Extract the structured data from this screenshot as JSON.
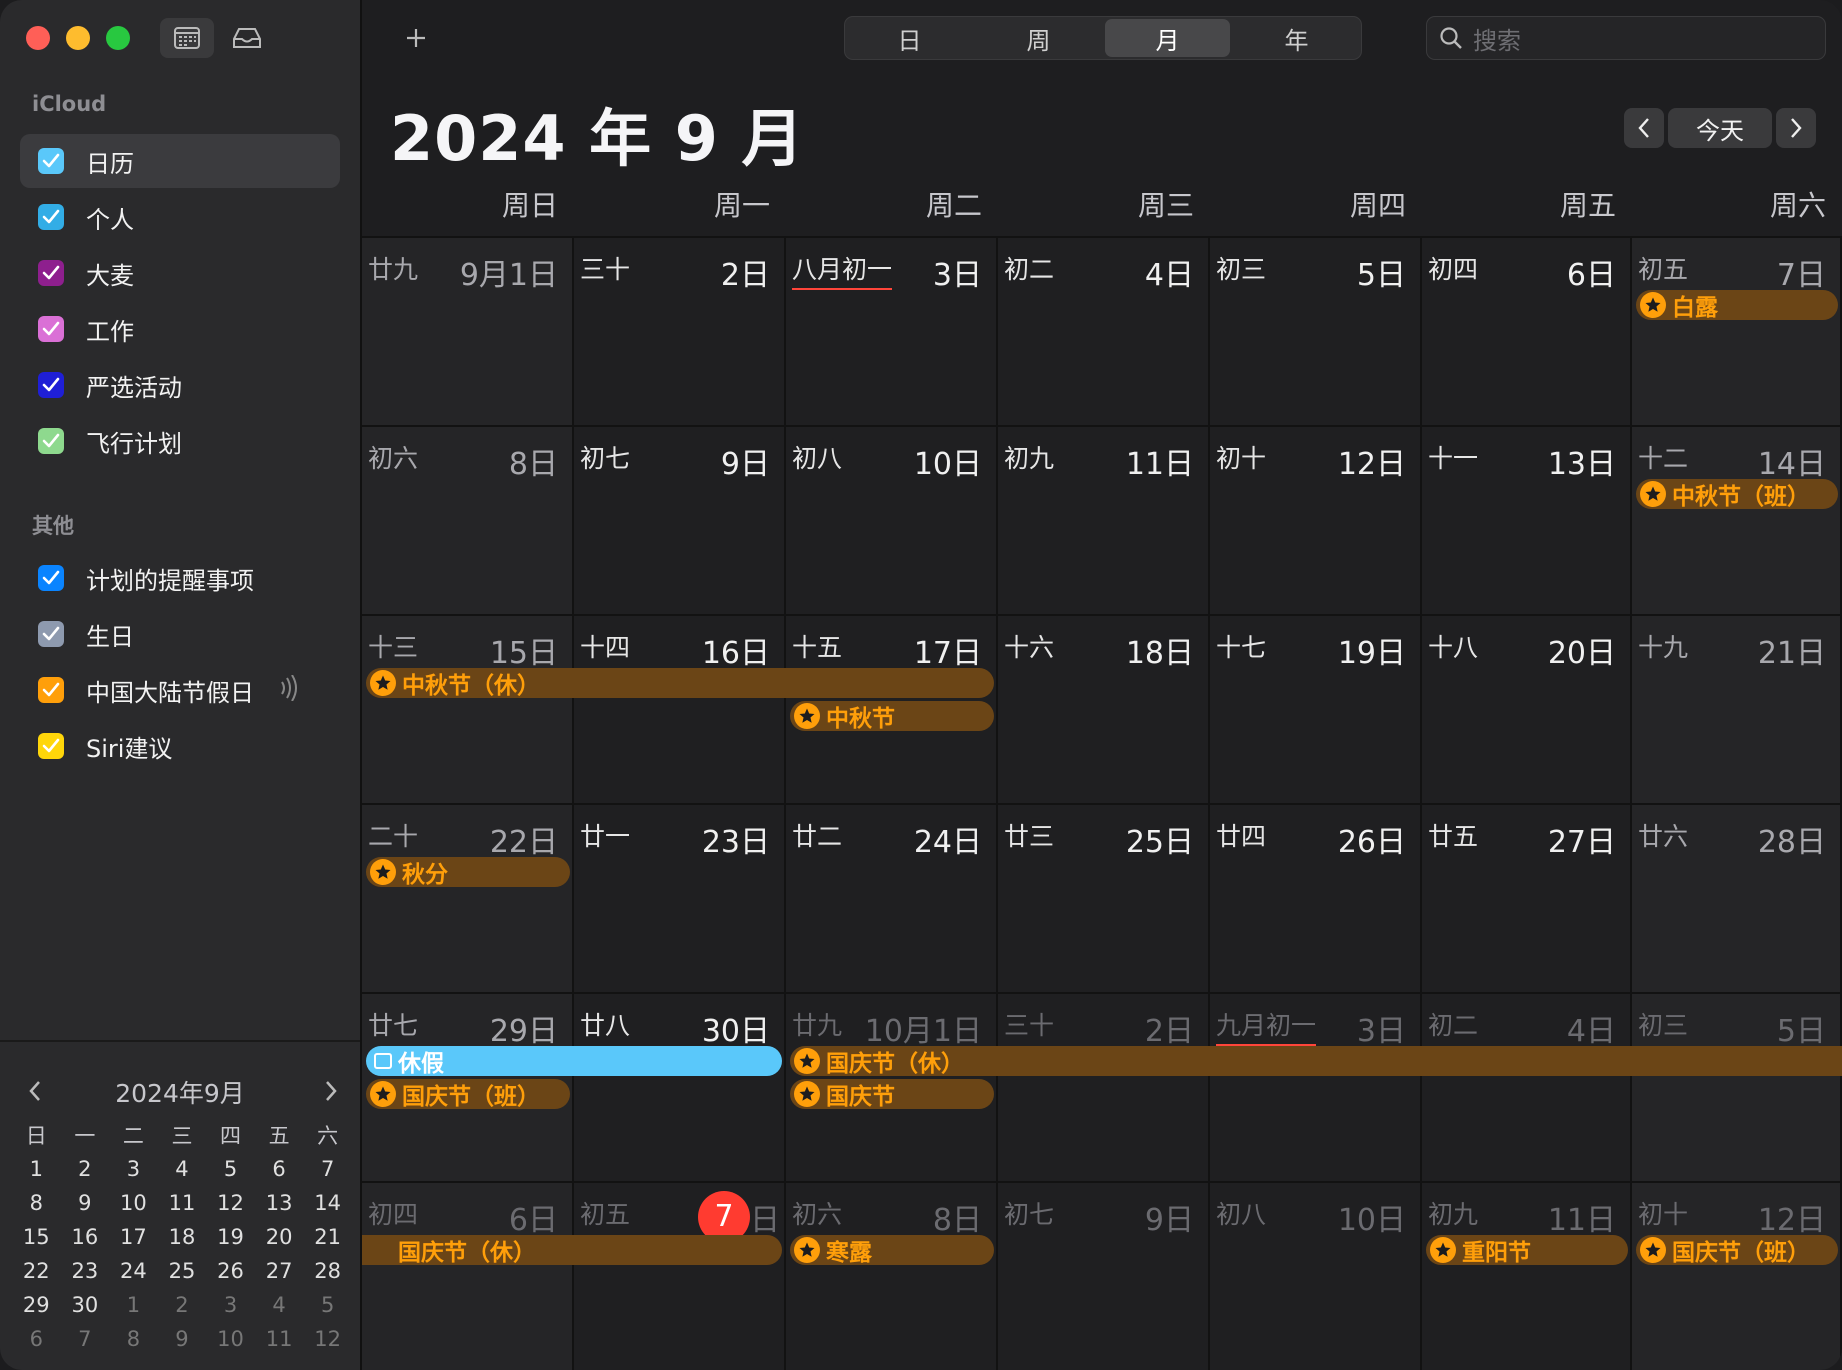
{
  "sidebar": {
    "icloud_heading": "iCloud",
    "icloud_calendars": [
      {
        "label": "日历",
        "color": "#5ac8fa",
        "selected": true
      },
      {
        "label": "个人",
        "color": "#32ade6"
      },
      {
        "label": "大麦",
        "color": "#8e1f8e"
      },
      {
        "label": "工作",
        "color": "#da70d6"
      },
      {
        "label": "严选活动",
        "color": "#1f1fd6"
      },
      {
        "label": "飞行计划",
        "color": "#8ed98e"
      }
    ],
    "other_heading": "其他",
    "other_calendars": [
      {
        "label": "计划的提醒事项",
        "color": "#0a84ff"
      },
      {
        "label": "生日",
        "color": "#8e9aaf"
      },
      {
        "label": "中国大陆节假日",
        "color": "#ff9f0a",
        "subscribed": true
      },
      {
        "label": "Siri建议",
        "color": "#ffd60a"
      }
    ],
    "mini_calendar": {
      "title": "2024年9月",
      "weekdays": [
        "日",
        "一",
        "二",
        "三",
        "四",
        "五",
        "六"
      ],
      "weeks": [
        [
          "1",
          "2",
          "3",
          "4",
          "5",
          "6",
          "7"
        ],
        [
          "8",
          "9",
          "10",
          "11",
          "12",
          "13",
          "14"
        ],
        [
          "15",
          "16",
          "17",
          "18",
          "19",
          "20",
          "21"
        ],
        [
          "22",
          "23",
          "24",
          "25",
          "26",
          "27",
          "28"
        ],
        [
          "29",
          "30",
          "1",
          "2",
          "3",
          "4",
          "5"
        ],
        [
          "6",
          "7",
          "8",
          "9",
          "10",
          "11",
          "12"
        ]
      ]
    }
  },
  "toolbar": {
    "add_label": "+",
    "views": [
      "日",
      "周",
      "月",
      "年"
    ],
    "active_view": "月",
    "search_placeholder": "搜索"
  },
  "header": {
    "month_title": "2024 年 9 月",
    "today_label": "今天"
  },
  "weekdays": [
    "周日",
    "周一",
    "周二",
    "周三",
    "周四",
    "周五",
    "周六"
  ],
  "weeks": [
    [
      {
        "lunar": "廿九",
        "solar": "9月1日"
      },
      {
        "lunar": "三十",
        "solar": "2日"
      },
      {
        "lunar": "八月初一",
        "solar": "3日",
        "marked": true
      },
      {
        "lunar": "初二",
        "solar": "4日"
      },
      {
        "lunar": "初三",
        "solar": "5日"
      },
      {
        "lunar": "初四",
        "solar": "6日"
      },
      {
        "lunar": "初五",
        "solar": "7日"
      }
    ],
    [
      {
        "lunar": "初六",
        "solar": "8日"
      },
      {
        "lunar": "初七",
        "solar": "9日"
      },
      {
        "lunar": "初八",
        "solar": "10日"
      },
      {
        "lunar": "初九",
        "solar": "11日"
      },
      {
        "lunar": "初十",
        "solar": "12日"
      },
      {
        "lunar": "十一",
        "solar": "13日"
      },
      {
        "lunar": "十二",
        "solar": "14日"
      }
    ],
    [
      {
        "lunar": "十三",
        "solar": "15日"
      },
      {
        "lunar": "十四",
        "solar": "16日"
      },
      {
        "lunar": "十五",
        "solar": "17日"
      },
      {
        "lunar": "十六",
        "solar": "18日"
      },
      {
        "lunar": "十七",
        "solar": "19日"
      },
      {
        "lunar": "十八",
        "solar": "20日"
      },
      {
        "lunar": "十九",
        "solar": "21日"
      }
    ],
    [
      {
        "lunar": "二十",
        "solar": "22日"
      },
      {
        "lunar": "廿一",
        "solar": "23日"
      },
      {
        "lunar": "廿二",
        "solar": "24日"
      },
      {
        "lunar": "廿三",
        "solar": "25日"
      },
      {
        "lunar": "廿四",
        "solar": "26日"
      },
      {
        "lunar": "廿五",
        "solar": "27日"
      },
      {
        "lunar": "廿六",
        "solar": "28日"
      }
    ],
    [
      {
        "lunar": "廿七",
        "solar": "29日"
      },
      {
        "lunar": "廿八",
        "solar": "30日"
      },
      {
        "lunar": "廿九",
        "solar": "10月1日",
        "other": true
      },
      {
        "lunar": "三十",
        "solar": "2日",
        "other": true
      },
      {
        "lunar": "九月初一",
        "solar": "3日",
        "other": true,
        "marked": true
      },
      {
        "lunar": "初二",
        "solar": "4日",
        "other": true
      },
      {
        "lunar": "初三",
        "solar": "5日",
        "other": true
      }
    ],
    [
      {
        "lunar": "初四",
        "solar": "6日",
        "other": true
      },
      {
        "lunar": "初五",
        "solar": "7",
        "solar_suffix": "日",
        "other": true,
        "today": true
      },
      {
        "lunar": "初六",
        "solar": "8日",
        "other": true
      },
      {
        "lunar": "初七",
        "solar": "9日",
        "other": true
      },
      {
        "lunar": "初八",
        "solar": "10日",
        "other": true
      },
      {
        "lunar": "初九",
        "solar": "11日",
        "other": true
      },
      {
        "lunar": "初十",
        "solar": "12日",
        "other": true
      }
    ]
  ],
  "events": [
    {
      "week": 0,
      "start": 6,
      "span": 1,
      "lane": 0,
      "title": "白露",
      "icon": "star-icon"
    },
    {
      "week": 1,
      "start": 6,
      "span": 1,
      "lane": 0,
      "title": "中秋节（班）",
      "icon": "star-icon"
    },
    {
      "week": 2,
      "start": 0,
      "span": 3,
      "lane": 0,
      "title": "中秋节（休）",
      "icon": "star-icon"
    },
    {
      "week": 2,
      "start": 2,
      "span": 1,
      "lane": 1,
      "title": "中秋节",
      "icon": "star-icon"
    },
    {
      "week": 3,
      "start": 0,
      "span": 1,
      "lane": 0,
      "title": "秋分",
      "icon": "star-icon"
    },
    {
      "week": 4,
      "start": 0,
      "span": 2,
      "lane": 0,
      "title": "休假",
      "icon": "calendar-icon",
      "color": "blue"
    },
    {
      "week": 4,
      "start": 2,
      "span": 5,
      "lane": 0,
      "title": "国庆节（休）",
      "icon": "star-icon",
      "continues": true
    },
    {
      "week": 4,
      "start": 0,
      "span": 1,
      "lane": 1,
      "title": "国庆节（班）",
      "icon": "star-icon"
    },
    {
      "week": 4,
      "start": 2,
      "span": 1,
      "lane": 1,
      "title": "国庆节",
      "icon": "star-icon"
    },
    {
      "week": 5,
      "start": 0,
      "span": 2,
      "lane": 0,
      "title": "国庆节（休）",
      "icon": "",
      "continued": true
    },
    {
      "week": 5,
      "start": 2,
      "span": 1,
      "lane": 0,
      "title": "寒露",
      "icon": "star-icon"
    },
    {
      "week": 5,
      "start": 5,
      "span": 1,
      "lane": 0,
      "title": "重阳节",
      "icon": "star-icon"
    },
    {
      "week": 5,
      "start": 6,
      "span": 1,
      "lane": 0,
      "title": "国庆节（班）",
      "icon": "star-icon"
    }
  ],
  "colors": {
    "holiday_text": "#ff9f0a",
    "holiday_bg": "#6b4516",
    "vacation_bg": "#5ac8fa",
    "today_circle": "#ff3b30"
  }
}
